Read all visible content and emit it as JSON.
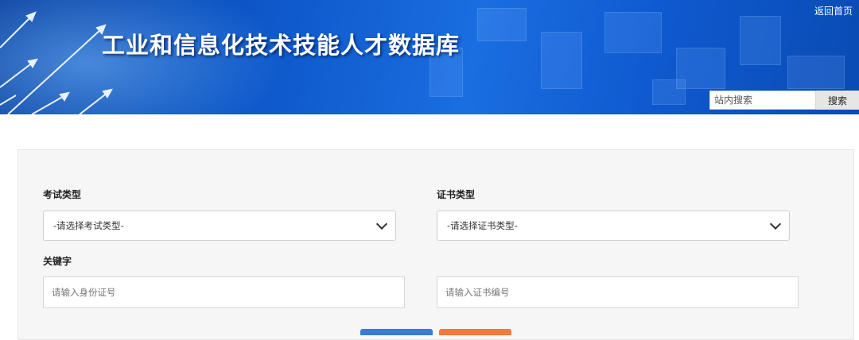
{
  "header": {
    "title": "工业和信息化技术技能人才数据库",
    "home_link": "返回首页",
    "search": {
      "placeholder": "站内搜索",
      "button_label": "搜索"
    }
  },
  "form": {
    "exam_type": {
      "label": "考试类型",
      "selected": "-请选择考试类型-"
    },
    "cert_type": {
      "label": "证书类型",
      "selected": "-请选择证书类型-"
    },
    "keyword": {
      "label": "关键字",
      "id_placeholder": "请输入身份证号",
      "cert_placeholder": "请输入证书编号"
    }
  },
  "colors": {
    "banner_blue": "#0d57c9",
    "query_button": "#3a7bd5",
    "reset_button": "#f07a3a"
  }
}
